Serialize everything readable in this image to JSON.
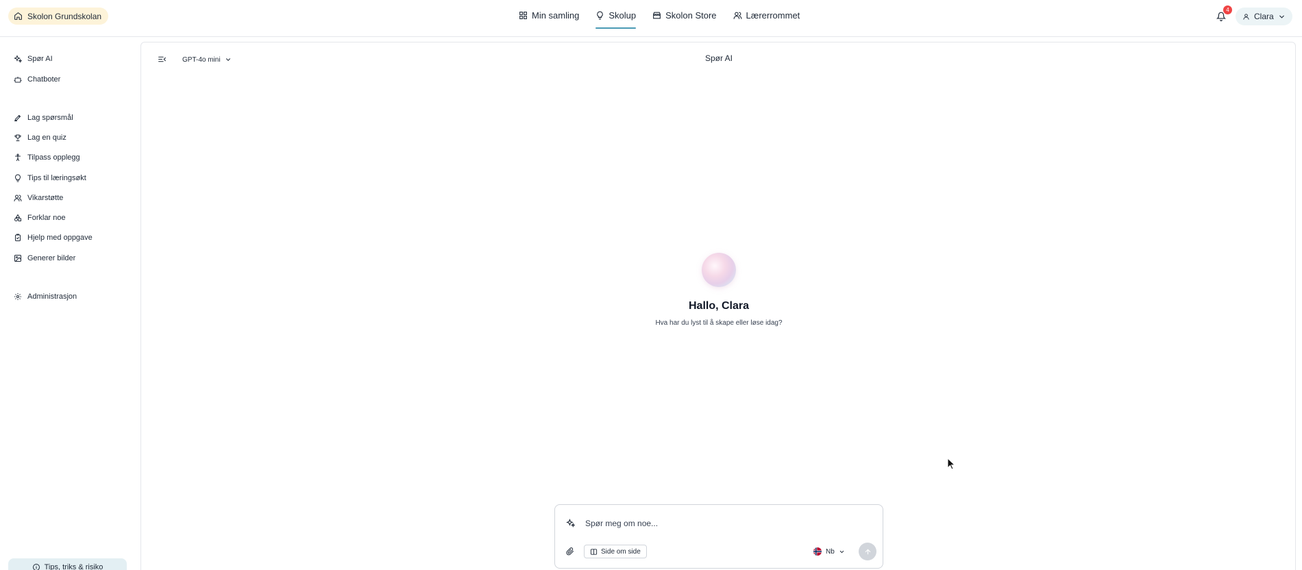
{
  "header": {
    "school": "Skolon Grundskolan",
    "nav": [
      {
        "label": "Min samling",
        "icon": "grid-icon"
      },
      {
        "label": "Skolup",
        "icon": "lightbulb-icon"
      },
      {
        "label": "Skolon Store",
        "icon": "store-icon"
      },
      {
        "label": "Lærerrommet",
        "icon": "users-icon"
      }
    ],
    "notifications_count": "4",
    "user_name": "Clara"
  },
  "sidebar": {
    "items": [
      {
        "label": "Spør AI",
        "icon": "sparkles-icon"
      },
      {
        "label": "Chatboter",
        "icon": "bot-icon"
      },
      {
        "label": "Lag spørsmål",
        "icon": "pen-icon"
      },
      {
        "label": "Lag en quiz",
        "icon": "trophy-icon"
      },
      {
        "label": "Tilpass opplegg",
        "icon": "accessibility-icon"
      },
      {
        "label": "Tips til læringsøkt",
        "icon": "lightbulb-icon"
      },
      {
        "label": "Vikarstøtte",
        "icon": "users-icon"
      },
      {
        "label": "Forklar noe",
        "icon": "shapes-icon"
      },
      {
        "label": "Hjelp med oppgave",
        "icon": "clipboard-icon"
      },
      {
        "label": "Generer bilder",
        "icon": "image-icon"
      },
      {
        "label": "Administrasjon",
        "icon": "gear-icon"
      }
    ],
    "tips_label": "Tips, triks & risiko"
  },
  "main": {
    "model": "GPT-4o mini",
    "title": "Spør AI",
    "greeting": "Hallo, Clara",
    "subgreeting": "Hva har du lyst til å skape eller løse idag?"
  },
  "composer": {
    "placeholder": "Spør meg om noe...",
    "side_by_side_label": "Side om side",
    "language": "Nb"
  },
  "colors": {
    "accent": "#4a9ab5",
    "school_pill": "#fdf3d9",
    "user_pill": "#ecf4f6",
    "badge": "#ef4444"
  }
}
